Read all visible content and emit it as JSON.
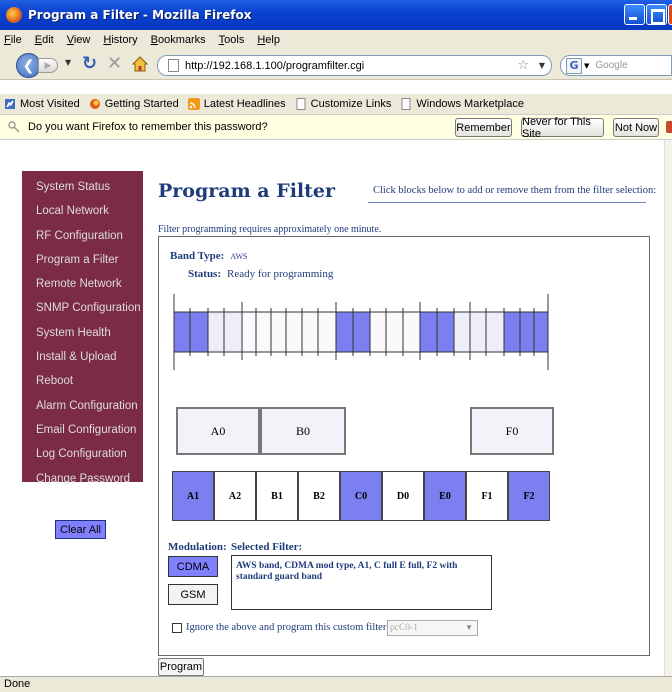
{
  "window": {
    "title": "Program a Filter - Mozilla Firefox"
  },
  "menu": [
    "File",
    "Edit",
    "View",
    "History",
    "Bookmarks",
    "Tools",
    "Help"
  ],
  "nav": {
    "url": "http://192.168.1.100/programfilter.cgi",
    "search_placeholder": "Google"
  },
  "bookmarks": [
    {
      "label": "Most Visited",
      "icon": "most-visited-icon"
    },
    {
      "label": "Getting Started",
      "icon": "firefox-icon"
    },
    {
      "label": "Latest Headlines",
      "icon": "rss-icon"
    },
    {
      "label": "Customize Links",
      "icon": "page-icon"
    },
    {
      "label": "Windows Marketplace",
      "icon": "page-icon"
    }
  ],
  "notification": {
    "message": "Do you want Firefox to remember this password?",
    "remember": "Remember",
    "never": "Never for This Site",
    "not_now": "Not Now"
  },
  "sidebar": {
    "items": [
      "System Status",
      "Local Network",
      "RF Configuration",
      "Program a Filter",
      "Remote Network",
      "SNMP Configuration",
      "System Health",
      "Install & Upload",
      "Reboot",
      "Alarm Configuration",
      "Email Configuration",
      "Log Configuration",
      "Change Password"
    ],
    "clear_all": "Clear All"
  },
  "main": {
    "title": "Program a Filter",
    "instruction": "Click blocks below to add or remove them from the filter selection:",
    "note": "Filter programming requires approximately one minute.",
    "band_type_label": "Band Type:",
    "band_type_value": "AWS",
    "status_label": "Status:",
    "status_value": "Ready for programming",
    "guard_blocks": [
      "A0",
      "B0",
      "F0"
    ],
    "blocks": [
      {
        "label": "A1",
        "selected": true
      },
      {
        "label": "A2",
        "selected": false
      },
      {
        "label": "B1",
        "selected": false
      },
      {
        "label": "B2",
        "selected": false
      },
      {
        "label": "C0",
        "selected": true
      },
      {
        "label": "D0",
        "selected": false
      },
      {
        "label": "E0",
        "selected": true
      },
      {
        "label": "F1",
        "selected": false
      },
      {
        "label": "F2",
        "selected": true
      }
    ],
    "modulation_label": "Modulation:",
    "modulation_options": [
      "CDMA",
      "GSM"
    ],
    "modulation_selected": "CDMA",
    "selected_filter_label": "Selected Filter:",
    "selected_filter_text": "AWS band, CDMA mod type, A1, C full E full, F2 with standard guard band",
    "custom_label": "Ignore the above and program this custom filter:",
    "custom_checked": false,
    "custom_value": "pcC0-1",
    "program_button": "Program"
  },
  "colors": {
    "sidebar_bg": "#7b2a47",
    "selected_block": "#7b7ff0",
    "heading": "#1f3c7a"
  },
  "status_bar": "Done"
}
